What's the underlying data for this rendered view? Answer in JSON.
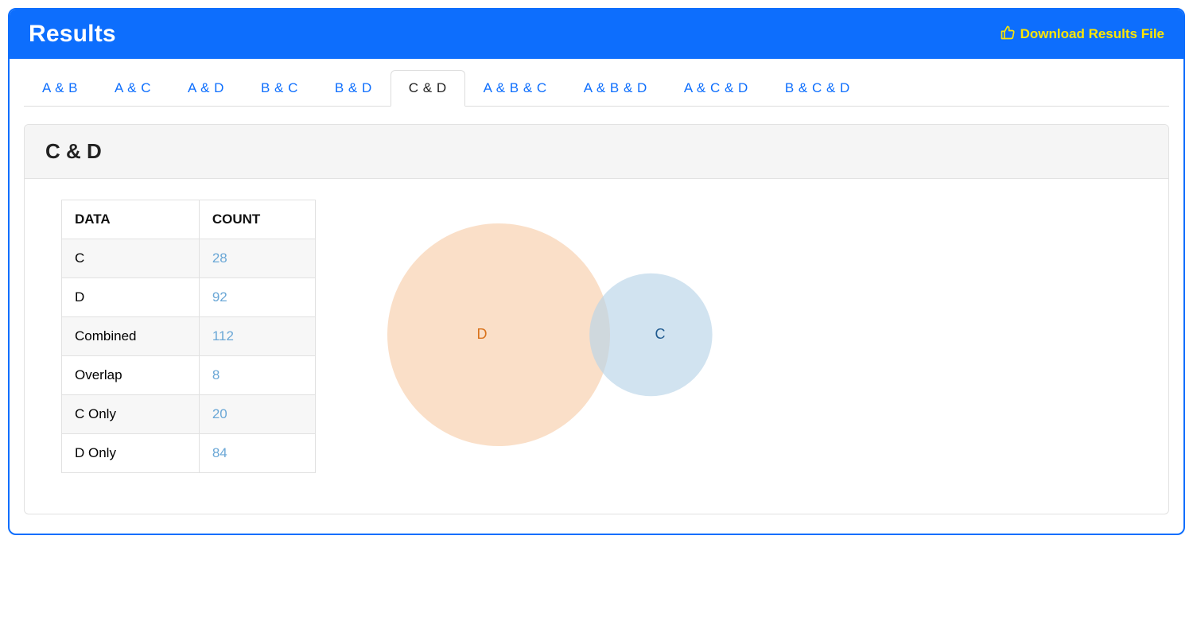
{
  "header": {
    "title": "Results",
    "download_label": "Download Results File"
  },
  "tabs": [
    {
      "label": "A & B",
      "active": false
    },
    {
      "label": "A & C",
      "active": false
    },
    {
      "label": "A & D",
      "active": false
    },
    {
      "label": "B & C",
      "active": false
    },
    {
      "label": "B & D",
      "active": false
    },
    {
      "label": "C & D",
      "active": true
    },
    {
      "label": "A & B & C",
      "active": false
    },
    {
      "label": "A & B & D",
      "active": false
    },
    {
      "label": "A & C & D",
      "active": false
    },
    {
      "label": "B & C & D",
      "active": false
    }
  ],
  "section": {
    "title": "C & D"
  },
  "table": {
    "headers": {
      "data": "DATA",
      "count": "COUNT"
    },
    "rows": [
      {
        "data": "C",
        "count": "28"
      },
      {
        "data": "D",
        "count": "92"
      },
      {
        "data": "Combined",
        "count": "112"
      },
      {
        "data": "Overlap",
        "count": "8"
      },
      {
        "data": "C Only",
        "count": "20"
      },
      {
        "data": "D Only",
        "count": "84"
      }
    ]
  },
  "chart_data": {
    "type": "venn",
    "sets": [
      {
        "name": "C",
        "size": 28,
        "only": 20,
        "color": "#b9d4e8",
        "label_color": "#1f5a8f"
      },
      {
        "name": "D",
        "size": 92,
        "only": 84,
        "color": "#f7ceab",
        "label_color": "#d9731c"
      }
    ],
    "overlap": 8,
    "combined": 112
  }
}
